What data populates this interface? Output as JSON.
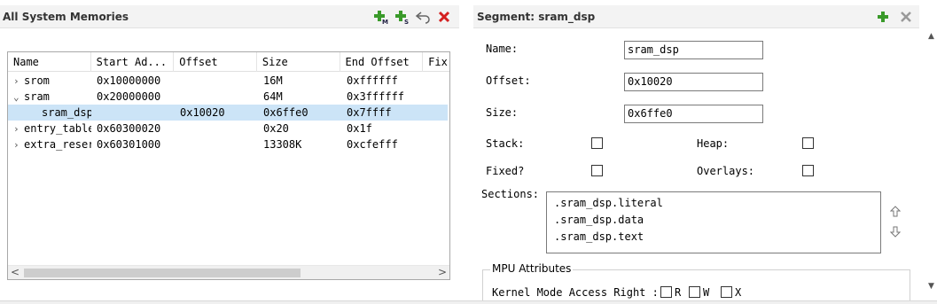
{
  "left_panel": {
    "title": "All System Memories",
    "icons": [
      "add-memory-icon",
      "add-segment-icon",
      "undo-icon",
      "delete-icon"
    ],
    "columns": [
      "Name",
      "Start Ad...",
      "Offset",
      "Size",
      "End Offset",
      "Fix"
    ],
    "rows": [
      {
        "expand": "›",
        "name": "srom",
        "start": "0x10000000",
        "offset": "",
        "size": "16M",
        "end": "0xffffff"
      },
      {
        "expand": "⌄",
        "name": "sram",
        "start": "0x20000000",
        "offset": "",
        "size": "64M",
        "end": "0x3ffffff"
      },
      {
        "expand": "",
        "name": "sram_dsp",
        "start": "",
        "offset": "0x10020",
        "size": "0x6ffe0",
        "end": "0x7ffff"
      },
      {
        "expand": "›",
        "name": "entry_table",
        "start": "0x60300020",
        "offset": "",
        "size": "0x20",
        "end": "0x1f"
      },
      {
        "expand": "›",
        "name": "extra_reserved",
        "start": "0x60301000",
        "offset": "",
        "size": "13308K",
        "end": "0xcfefff"
      }
    ],
    "scroll_left": "<",
    "scroll_right": ">"
  },
  "right_panel": {
    "title": "Segment: sram_dsp",
    "icons": [
      "add-icon",
      "close-icon"
    ],
    "name_label": "Name:",
    "name_value": "sram_dsp",
    "offset_label": "Offset:",
    "offset_value": "0x10020",
    "size_label": "Size:",
    "size_value": "0x6ffe0",
    "stack_label": "Stack:",
    "heap_label": "Heap:",
    "fixed_label": "Fixed?",
    "overlays_label": "Overlays:",
    "sections_label": "Sections:",
    "sections": [
      ".sram_dsp.literal",
      ".sram_dsp.data",
      ".sram_dsp.text"
    ],
    "mpu_title": "MPU Attributes",
    "kernel_label": "Kernel Mode Access Right :",
    "r_label": "R",
    "w_label": "W",
    "x_label": "X"
  },
  "colors": {
    "selection": "#cce4f7",
    "add_green": "#3a9a2a",
    "delete_red": "#d42020"
  }
}
